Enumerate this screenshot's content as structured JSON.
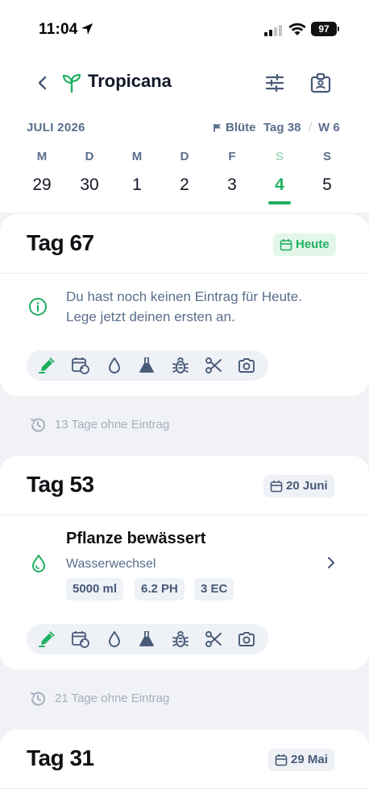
{
  "status_bar": {
    "time": "11:04",
    "battery": "97"
  },
  "header": {
    "title": "Tropicana"
  },
  "calendar": {
    "month": "JULI 2026",
    "phase": "Blüte",
    "day_label": "Tag 38",
    "separator": "/",
    "week_label": "W 6",
    "days": [
      {
        "letter": "M",
        "number": "29"
      },
      {
        "letter": "D",
        "number": "30"
      },
      {
        "letter": "M",
        "number": "1"
      },
      {
        "letter": "D",
        "number": "2"
      },
      {
        "letter": "F",
        "number": "3"
      },
      {
        "letter": "S",
        "number": "4",
        "selected": true
      },
      {
        "letter": "S",
        "number": "5"
      }
    ]
  },
  "cards": [
    {
      "title": "Tag 67",
      "date_badge": "Heute",
      "info": [
        "Du hast noch keinen Eintrag für Heute.",
        "Lege jetzt deinen ersten an."
      ]
    },
    {
      "title": "Tag 53",
      "date_badge": "20 Juni",
      "entry": {
        "title": "Pflanze bewässert",
        "subtitle": "Wasserwechsel",
        "chips": [
          "5000 ml",
          "6.2 PH",
          "3 EC"
        ]
      }
    },
    {
      "title": "Tag 31",
      "date_badge": "29 Mai"
    }
  ],
  "gaps": [
    "13 Tage ohne Eintrag",
    "21 Tage ohne Eintrag"
  ],
  "toolbar_actions": [
    "edit-icon",
    "calendar-repeat-icon",
    "water-drop-icon",
    "flask-icon",
    "bug-icon",
    "scissors-icon",
    "camera-icon"
  ],
  "colors": {
    "accent": "#1fb060",
    "muted": "#5a6e8c",
    "background": "#f0f2f5"
  }
}
